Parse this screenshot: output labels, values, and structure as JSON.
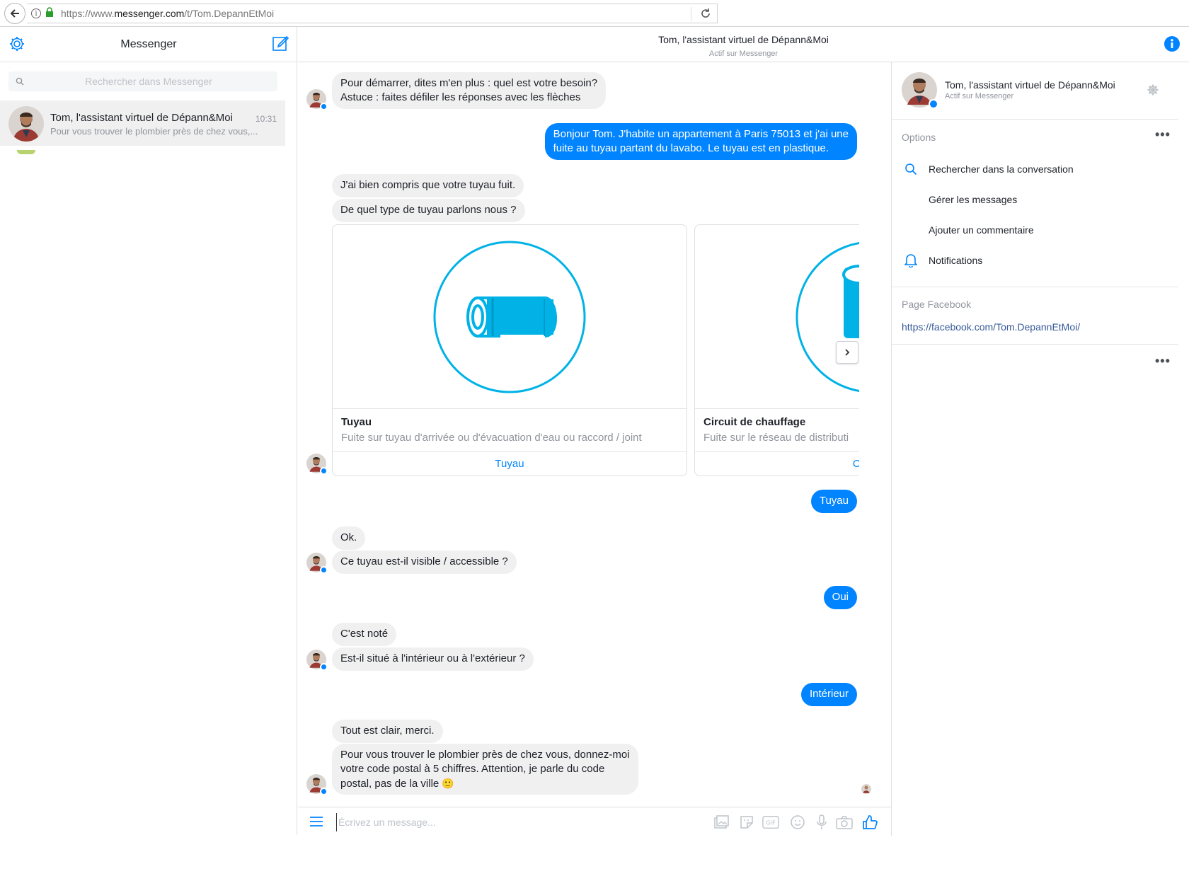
{
  "browser": {
    "url_prefix": "https://www.",
    "url_domain": "messenger.com",
    "url_path": "/t/Tom.DepannEtMoi"
  },
  "left": {
    "title": "Messenger",
    "search_placeholder": "Rechercher dans Messenger",
    "conversation": {
      "name": "Tom, l'assistant virtuel de Dépann&Moi",
      "time": "10:31",
      "snippet": "Pour vous trouver le plombier près de chez vous,..."
    }
  },
  "header": {
    "title": "Tom, l'assistant virtuel de Dépann&Moi",
    "status": "Actif sur Messenger"
  },
  "messages": {
    "m1": "Pour démarrer, dites m'en plus : quel est votre besoin?",
    "m1b": "Astuce : faites défiler les réponses avec les flèches",
    "m2": "Bonjour Tom. J'habite un appartement à Paris 75013 et j'ai une",
    "m2b": "fuite au tuyau partant du lavabo. Le tuyau est en plastique.",
    "m3": "J'ai bien compris que votre tuyau fuit.",
    "m4": "De quel type de tuyau parlons nous ?",
    "m5": "Tuyau",
    "m6": "Ok.",
    "m7": "Ce tuyau est-il visible / accessible ?",
    "m8": "Oui",
    "m9": "C'est noté",
    "m10": "Est-il situé à l'intérieur ou à l'extérieur ?",
    "m11": "Intérieur",
    "m12": "Tout est clair, merci.",
    "m13a": "Pour vous trouver le plombier près de chez vous, donnez-moi",
    "m13b": "votre code postal à 5 chiffres. Attention, je parle du code",
    "m13c": "postal, pas de la ville",
    "m13_emoji": "🙂"
  },
  "cards": [
    {
      "title": "Tuyau",
      "subtitle": "Fuite sur tuyau d'arrivée ou d'évacuation d'eau ou raccord / joint",
      "button": "Tuyau"
    },
    {
      "title": "Circuit de chauffage",
      "subtitle": "Fuite sur le réseau de distributi",
      "button": "Circuit c"
    }
  ],
  "composer": {
    "placeholder": "Écrivez un message..."
  },
  "right": {
    "name": "Tom, l'assistant virtuel de Dépann&Moi",
    "status": "Actif sur Messenger",
    "options_label": "Options",
    "items": [
      "Rechercher dans la conversation",
      "Gérer les messages",
      "Ajouter un commentaire",
      "Notifications"
    ],
    "fb_label": "Page Facebook",
    "fb_link": "https://facebook.com/Tom.DepannEtMoi/"
  },
  "colors": {
    "accent": "#0084ff",
    "incoming": "#f1f0f0",
    "pipe": "#00b2e6"
  },
  "icons": [
    "back-arrow-icon",
    "info-icon",
    "lock-icon",
    "reload-icon",
    "gear-icon",
    "compose-icon",
    "search-icon",
    "chevron-right-icon",
    "hamburger-icon",
    "image-icon",
    "sticker-icon",
    "gif-icon",
    "emoji-icon",
    "mic-icon",
    "camera-icon",
    "thumbs-up-icon",
    "bell-icon",
    "more-icon"
  ]
}
